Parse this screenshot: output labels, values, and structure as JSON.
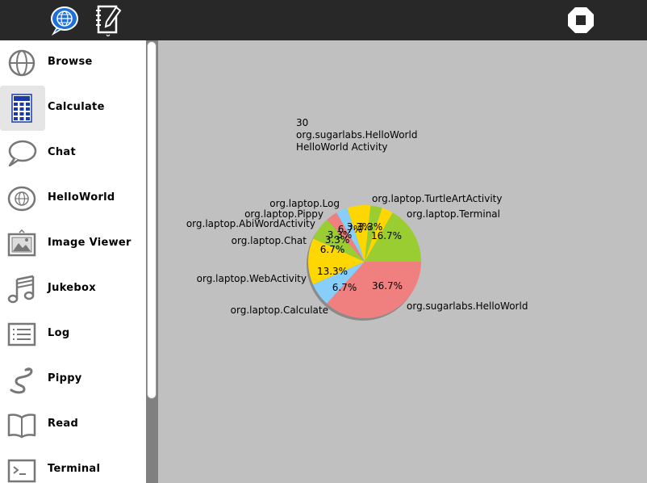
{
  "toolbar": {
    "icons": [
      "globe-speech-icon",
      "journal-pencil-icon",
      "stop-icon"
    ]
  },
  "sidebar": {
    "items": [
      {
        "label": "Browse",
        "icon": "globe-icon"
      },
      {
        "label": "Calculate",
        "icon": "calculator-icon",
        "selected": true
      },
      {
        "label": "Chat",
        "icon": "speech-bubble-icon"
      },
      {
        "label": "HelloWorld",
        "icon": "hello-globe-icon"
      },
      {
        "label": "Image Viewer",
        "icon": "image-icon"
      },
      {
        "label": "Jukebox",
        "icon": "music-note-icon"
      },
      {
        "label": "Log",
        "icon": "list-icon"
      },
      {
        "label": "Pippy",
        "icon": "snake-icon"
      },
      {
        "label": "Read",
        "icon": "book-icon"
      },
      {
        "label": "Terminal",
        "icon": "terminal-icon"
      }
    ]
  },
  "header": {
    "line1": "30",
    "line2": "org.sugarlabs.HelloWorld",
    "line3": "HelloWorld Activity"
  },
  "chart_data": {
    "type": "pie",
    "total": 30,
    "slices": [
      {
        "label": "org.sugarlabs.HelloWorld",
        "value": 36.7,
        "color": "#f08080"
      },
      {
        "label": "org.laptop.Calculate",
        "value": 6.7,
        "color": "#87cefa"
      },
      {
        "label": "org.laptop.WebActivity",
        "value": 13.3,
        "color": "#ffd700"
      },
      {
        "label": "org.laptop.Chat",
        "value": 6.7,
        "color": "#9acd32"
      },
      {
        "label": "org.laptop.AbiWordActivity",
        "value": 3.3,
        "color": "#f08080"
      },
      {
        "label": "org.laptop.Pippy",
        "value": 3.3,
        "color": "#87cefa"
      },
      {
        "label": "org.laptop.Log",
        "value": 6.7,
        "color": "#ffd700"
      },
      {
        "label": "",
        "value": 3.3,
        "color": "#9acd32"
      },
      {
        "label": "org.laptop.TurtleArtActivity",
        "value": 3.3,
        "color": "#ffd700"
      },
      {
        "label": "org.laptop.Terminal",
        "value": 16.7,
        "color": "#9acd32"
      }
    ],
    "pct_labels": [
      "36.7%",
      "6.7%",
      "13.3%",
      "6.7%",
      "3.3%",
      "3.3%",
      "6.7%",
      "3.3%",
      "3.3%",
      "16.7%"
    ]
  }
}
